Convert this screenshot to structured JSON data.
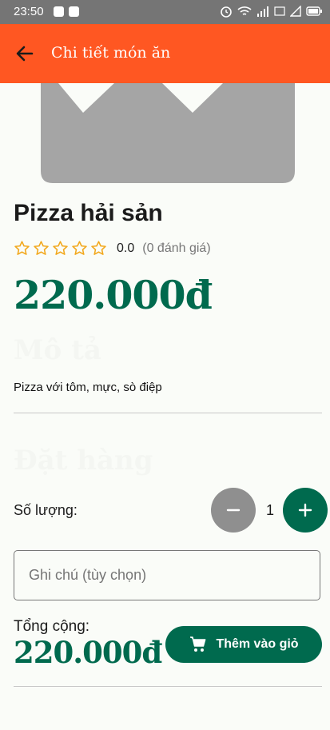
{
  "status_bar": {
    "time": "23:50"
  },
  "app_bar": {
    "title": "Chi tiết món ăn",
    "back_icon": "arrow-left-icon"
  },
  "product": {
    "name": "Pizza hải sản",
    "rating_score": "0.0",
    "rating_count": "(0 đánh giá)",
    "stars": 0,
    "price": "220.000đ",
    "description_heading": "Mô tả",
    "description": "Pizza với tôm, mực, sò điệp"
  },
  "order": {
    "heading": "Đặt hàng",
    "quantity_label": "Số lượng:",
    "quantity": "1",
    "note_placeholder": "Ghi chú (tùy chọn)",
    "total_label": "Tổng cộng:",
    "total_value": "220.000đ",
    "add_to_cart_label": "Thêm vào giỏ"
  },
  "colors": {
    "app_bar": "#ff5722",
    "primary": "#006a4e",
    "star": "#f2a81d",
    "minus_button": "#8f8f8f"
  }
}
